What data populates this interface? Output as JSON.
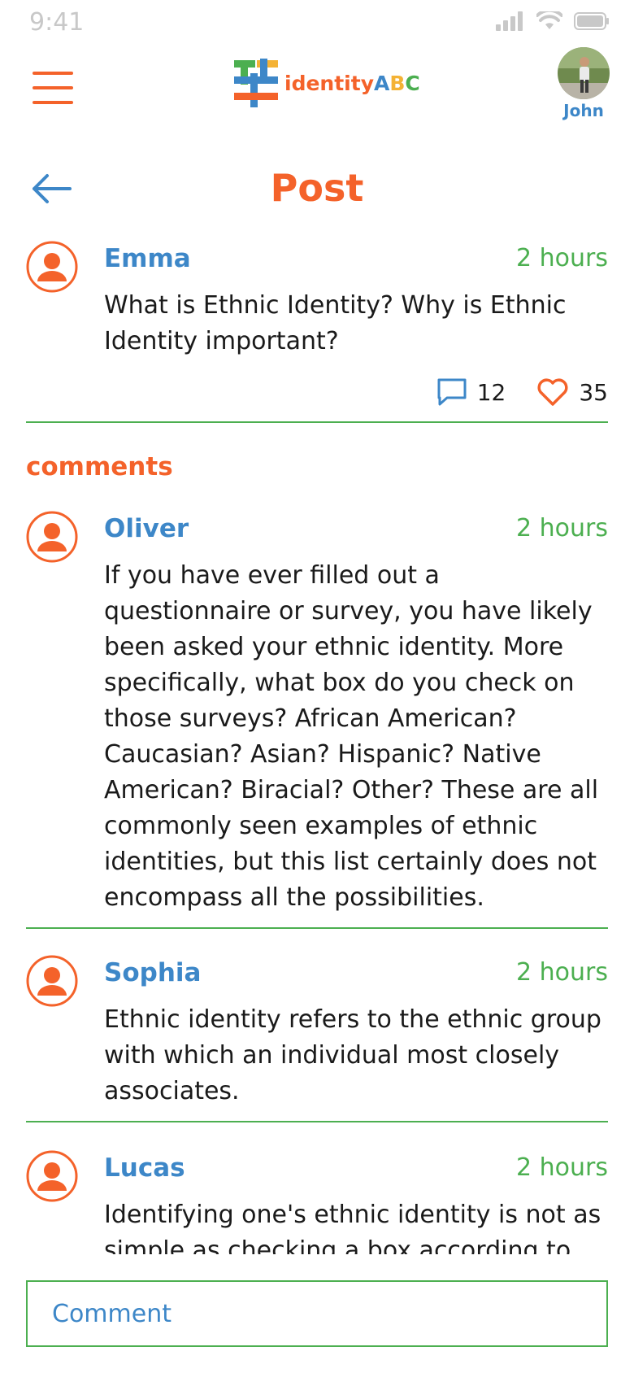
{
  "status_bar": {
    "time": "9:41"
  },
  "header": {
    "logo_parts": [
      "identity",
      "A",
      "B",
      "C"
    ],
    "user_name": "John"
  },
  "page": {
    "title": "Post"
  },
  "post": {
    "author": "Emma",
    "time": "2 hours",
    "text": "What is Ethnic Identity?  Why is Ethnic Identity important?",
    "comment_count": "12",
    "like_count": "35"
  },
  "comments_label": "comments",
  "comments": [
    {
      "author": "Oliver",
      "time": "2 hours",
      "text": "If you have ever filled out a questionnaire or survey, you have likely been asked your ethnic identity. More specifically, what box do you check on those surveys? African American? Caucasian? Asian? Hispanic? Native American? Biracial? Other? These are all commonly seen examples of ethnic identities, but this list certainly does not encompass all the possibilities."
    },
    {
      "author": "Sophia",
      "time": "2 hours",
      "text": "Ethnic identity refers to the ethnic group with which an individual most closely associates."
    },
    {
      "author": "Lucas",
      "time": "2 hours",
      "text": "Identifying one's ethnic identity is not as simple as checking a box according to"
    }
  ],
  "comment_input": {
    "placeholder": "Comment",
    "value": ""
  },
  "colors": {
    "accent_orange": "#f4622a",
    "accent_blue": "#3d87c8",
    "accent_green": "#4caf50",
    "accent_yellow": "#f4b234"
  }
}
